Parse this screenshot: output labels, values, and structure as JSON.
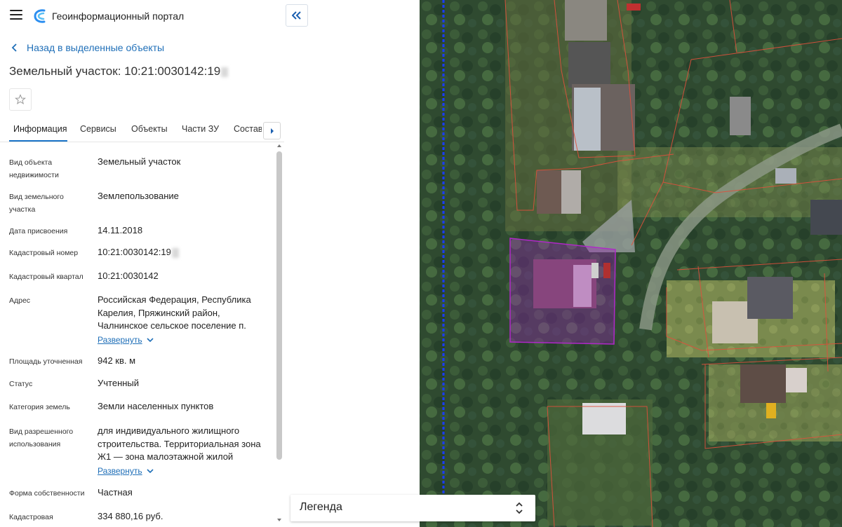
{
  "header": {
    "app_title": "Геоинформационный портал",
    "menu_icon": "hamburger-icon",
    "logo_icon": "portal-logo-icon"
  },
  "nav": {
    "back_label": "Назад в выделенные объекты"
  },
  "object": {
    "title": "Земельный участок: 10:21:0030142:19"
  },
  "tabs": [
    {
      "label": "Информация",
      "active": true
    },
    {
      "label": "Сервисы"
    },
    {
      "label": "Объекты"
    },
    {
      "label": "Части ЗУ"
    },
    {
      "label": "Состав"
    }
  ],
  "properties": [
    {
      "label": "Вид объекта недвижимости",
      "value": "Земельный участок"
    },
    {
      "label": "Вид земельного участка",
      "value": "Землепользование"
    },
    {
      "label": "Дата присвоения",
      "value": "14.11.2018"
    },
    {
      "label": "Кадастровый номер",
      "value": "10:21:0030142:19"
    },
    {
      "label": "Кадастровый квартал",
      "value": "10:21:0030142"
    },
    {
      "label": "Адрес",
      "value": "Российская Федерация, Республика Карелия, Пряжинский район, Чалнинское сельское поселение п.",
      "expand": "Развернуть"
    },
    {
      "label": "Площадь уточненная",
      "value": "942 кв. м"
    },
    {
      "label": "Статус",
      "value": "Учтенный"
    },
    {
      "label": "Категория земель",
      "value": "Земли населенных пунктов"
    },
    {
      "label": "Вид разрешенного использования",
      "value": "для индивидуального жилищного строительства. Территориальная зона Ж1 — зона малоэтажной жилой",
      "expand": "Развернуть"
    },
    {
      "label": "Форма собственности",
      "value": "Частная"
    },
    {
      "label": "Кадастровая",
      "value": "334 880,16 руб."
    }
  ],
  "legend": {
    "label": "Легенда"
  },
  "colors": {
    "accent": "#1a73c8",
    "link": "#1f6fb8",
    "parcel_highlight": "#a020c0",
    "parcel_lines": "#e0503c"
  }
}
